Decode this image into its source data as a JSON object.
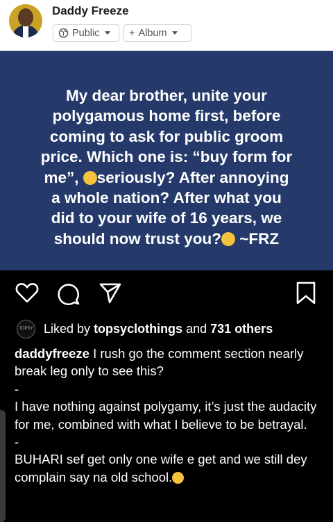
{
  "header": {
    "username": "Daddy Freeze",
    "privacy_label": "Public",
    "album_label": "Album",
    "album_prefix": "+"
  },
  "post": {
    "lines": [
      "My dear brother, unite your",
      "polygamous home first, before",
      "coming to ask for public groom",
      "price. Which one is: “buy form for",
      "me”,",
      "seriously? After annoying",
      "a whole nation? After what you",
      "did to your wife of 16 years, we",
      "should now trust you?",
      "~FRZ"
    ]
  },
  "likes": {
    "avatar_text": "TOPSY",
    "prefix": "Liked by",
    "user": "topsyclothings",
    "conj": "and",
    "count": "731 others"
  },
  "caption": {
    "username": "daddyfreeze",
    "p1": "I rush go the comment section nearly break leg only to see this?",
    "sep1": "-",
    "p2": "I have nothing against polygamy, it’s just the audacity for me, combined with what I believe to be betrayal.",
    "sep2": "-",
    "p3": "BUHARI sef get only one wife e get and we still dey complain say na old school."
  },
  "icons": [
    "heart-icon",
    "comment-icon",
    "share-icon",
    "bookmark-icon",
    "globe-icon",
    "eye-roll-emoji",
    "laughing-emoji"
  ]
}
